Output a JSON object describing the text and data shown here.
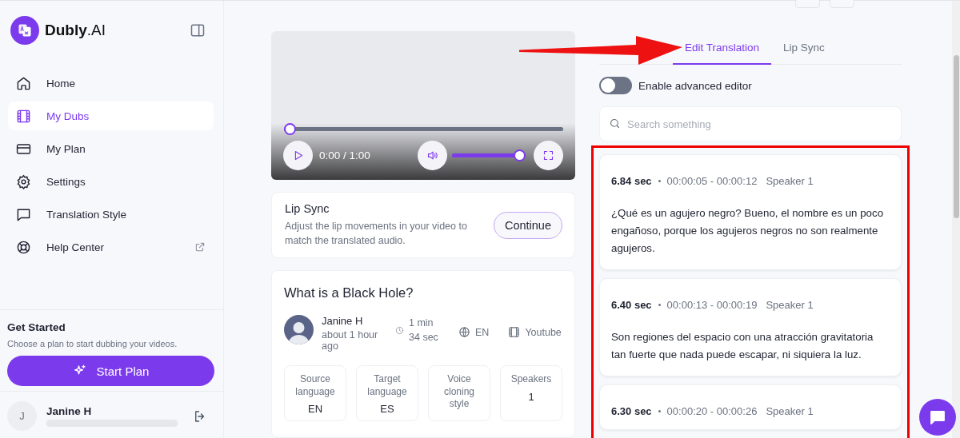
{
  "sidebar": {
    "brand": "**Dubly**.AI",
    "nav": [
      {
        "label": "Home",
        "selected": false,
        "external": false
      },
      {
        "label": "My Dubs",
        "selected": true,
        "external": false
      },
      {
        "label": "My Plan",
        "selected": false,
        "external": false
      },
      {
        "label": "Settings",
        "selected": false,
        "external": false
      },
      {
        "label": "Translation Style",
        "selected": false,
        "external": false
      },
      {
        "label": "Help Center",
        "selected": false,
        "external": true
      }
    ],
    "get_started": {
      "title": "Get Started",
      "text": "Choose a plan to start dubbing your videos.",
      "button": "Start Plan"
    },
    "user": {
      "initial": "J",
      "name": "Janine H"
    }
  },
  "player": {
    "progress": {
      "level": 0
    },
    "time": "0:00 / 1:00",
    "volume": {
      "level": 1
    }
  },
  "lip_sync_card": {
    "title": "Lip Sync",
    "text": "Adjust the lip movements in your video to match the translated audio.",
    "button": "Continue"
  },
  "video_card": {
    "title": "What is a Black Hole?",
    "author": "Janine H",
    "uploaded": "about 1 hour ago",
    "duration": "1 min 34 sec",
    "language": "EN",
    "source": "Youtube",
    "stats": [
      {
        "label": "Source language",
        "value": "EN"
      },
      {
        "label": "Target language",
        "value": "ES"
      },
      {
        "label": "Voice cloning style"
      },
      {
        "label": "Speakers",
        "value": "1"
      }
    ]
  },
  "tabs": [
    {
      "label": "Edit Translation",
      "selected": true
    },
    {
      "label": "Lip Sync",
      "selected": false
    }
  ],
  "advanced_editor": {
    "label": "Enable advanced editor",
    "on": false
  },
  "search": {
    "placeholder": "Search something"
  },
  "segments": [
    {
      "duration": "6.84 sec",
      "range": "00:00:05 - 00:00:12",
      "speaker": "Speaker 1",
      "text": "¿Qué es un agujero negro? Bueno, el nombre es un poco engañoso, porque los agujeros negros no son realmente agujeros."
    },
    {
      "duration": "6.40 sec",
      "range": "00:00:13 - 00:00:19",
      "speaker": "Speaker 1",
      "text": "Son regiones del espacio con una atracción gravitatoria tan fuerte que nada puede escapar, ni siquiera la luz."
    },
    {
      "duration": "6.30 sec",
      "range": "00:00:20 - 00:00:26",
      "speaker": "Speaker 1"
    }
  ]
}
